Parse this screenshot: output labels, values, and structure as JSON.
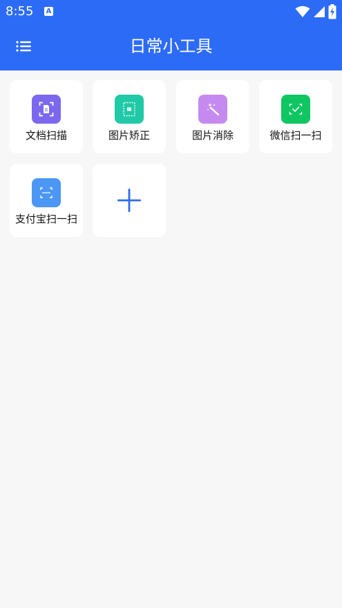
{
  "status_bar": {
    "time": "8:55",
    "notification_glyph": "A",
    "icons": [
      "a-notification-icon",
      "wifi-icon",
      "cell-signal-icon",
      "battery-charging-icon"
    ]
  },
  "app_bar": {
    "title": "日常小工具",
    "menu_icon": "list-menu-icon"
  },
  "colors": {
    "primary": "#2c6bf6",
    "background": "#f7f7f7",
    "card": "#ffffff",
    "doc_scan": "#7b68ee",
    "img_correct": "#20c9a7",
    "img_erase": "#c58af0",
    "wechat_scan": "#0fc662",
    "alipay_scan": "#4c97f5"
  },
  "tools": [
    {
      "label": "文档扫描",
      "icon": "document-scan-icon"
    },
    {
      "label": "图片矫正",
      "icon": "image-correct-icon"
    },
    {
      "label": "图片消除",
      "icon": "magic-wand-icon"
    },
    {
      "label": "微信扫一扫",
      "icon": "wechat-scan-icon"
    },
    {
      "label": "支付宝扫一扫",
      "icon": "alipay-scan-icon"
    }
  ],
  "add_button": {
    "icon": "plus-icon"
  }
}
